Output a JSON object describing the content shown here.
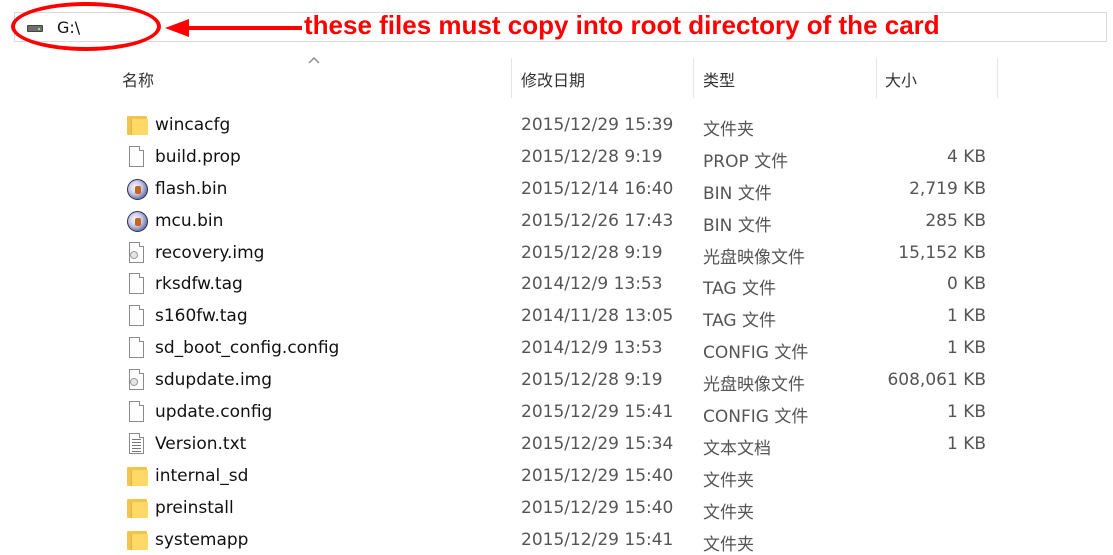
{
  "address_bar": {
    "path": "G:\\"
  },
  "annotation": {
    "text": "these files must copy into root directory of the card",
    "color": "#ff0000"
  },
  "columns": {
    "name": "名称",
    "date": "修改日期",
    "type": "类型",
    "size": "大小"
  },
  "files": [
    {
      "name": "wincacfg",
      "date": "2015/12/29 15:39",
      "type": "文件夹",
      "size": "",
      "icon": "folder-icon"
    },
    {
      "name": "build.prop",
      "date": "2015/12/28 9:19",
      "type": "PROP 文件",
      "size": "4 KB",
      "icon": "file-icon"
    },
    {
      "name": "flash.bin",
      "date": "2015/12/14 16:40",
      "type": "BIN 文件",
      "size": "2,719 KB",
      "icon": "bin-icon"
    },
    {
      "name": "mcu.bin",
      "date": "2015/12/26 17:43",
      "type": "BIN 文件",
      "size": "285 KB",
      "icon": "bin-icon"
    },
    {
      "name": "recovery.img",
      "date": "2015/12/28 9:19",
      "type": "光盘映像文件",
      "size": "15,152 KB",
      "icon": "disc-image-icon"
    },
    {
      "name": "rksdfw.tag",
      "date": "2014/12/9 13:53",
      "type": "TAG 文件",
      "size": "0 KB",
      "icon": "file-icon"
    },
    {
      "name": "s160fw.tag",
      "date": "2014/11/28 13:05",
      "type": "TAG 文件",
      "size": "1 KB",
      "icon": "file-icon"
    },
    {
      "name": "sd_boot_config.config",
      "date": "2014/12/9 13:53",
      "type": "CONFIG 文件",
      "size": "1 KB",
      "icon": "file-icon"
    },
    {
      "name": "sdupdate.img",
      "date": "2015/12/28 9:19",
      "type": "光盘映像文件",
      "size": "608,061 KB",
      "icon": "disc-image-icon"
    },
    {
      "name": "update.config",
      "date": "2015/12/29 15:41",
      "type": "CONFIG 文件",
      "size": "1 KB",
      "icon": "file-icon"
    },
    {
      "name": "Version.txt",
      "date": "2015/12/29 15:34",
      "type": "文本文档",
      "size": "1 KB",
      "icon": "text-file-icon"
    },
    {
      "name": "internal_sd",
      "date": "2015/12/29 15:40",
      "type": "文件夹",
      "size": "",
      "icon": "folder-icon"
    },
    {
      "name": "preinstall",
      "date": "2015/12/29 15:40",
      "type": "文件夹",
      "size": "",
      "icon": "folder-icon"
    },
    {
      "name": "systemapp",
      "date": "2015/12/29 15:41",
      "type": "文件夹",
      "size": "",
      "icon": "folder-icon"
    }
  ]
}
